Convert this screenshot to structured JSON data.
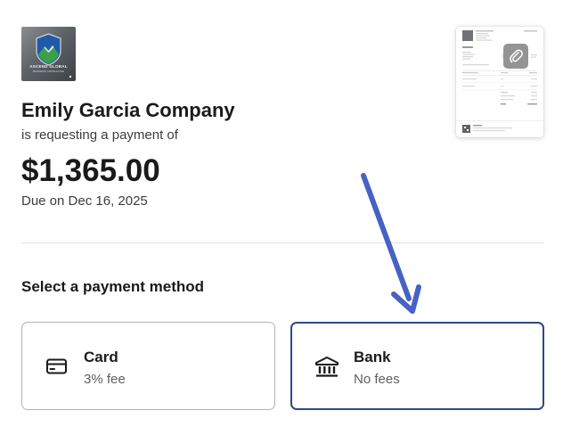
{
  "merchant": {
    "logo_text": "ASCEND GLOBAL",
    "logo_subtext": "BUSINESS CONSULTING",
    "name": "Emily Garcia Company",
    "request_text": "is requesting a payment of"
  },
  "payment": {
    "amount": "$1,365.00",
    "due_text": "Due on Dec 16, 2025"
  },
  "invoice_preview": {
    "icon": "paperclip-icon"
  },
  "payment_methods": {
    "title": "Select a payment method",
    "options": [
      {
        "id": "card",
        "label": "Card",
        "fee": "3% fee",
        "icon": "credit-card-icon",
        "selected": false
      },
      {
        "id": "bank",
        "label": "Bank",
        "fee": "No fees",
        "icon": "bank-icon",
        "selected": true
      }
    ]
  },
  "colors": {
    "selected_border": "#2c4a86",
    "annotation_arrow": "#4562c4",
    "text_primary": "#1a1a1a",
    "text_secondary": "#5f5f5f"
  }
}
